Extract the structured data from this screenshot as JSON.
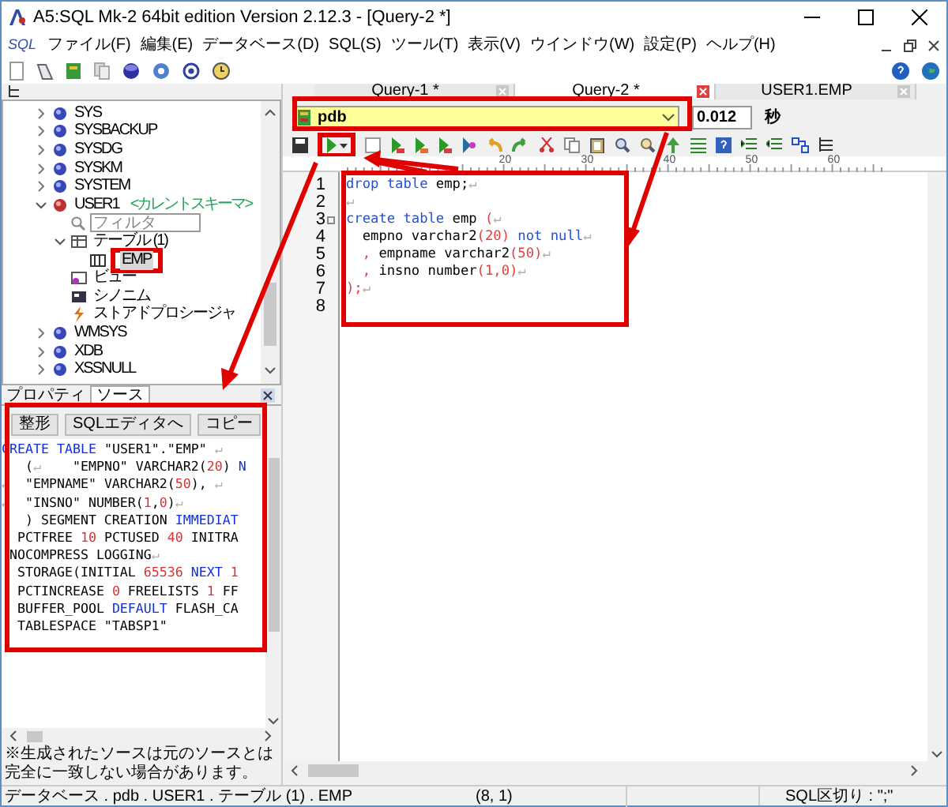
{
  "window": {
    "title": "A5:SQL Mk-2 64bit edition Version 2.12.3 - [Query-2 *]"
  },
  "menu": {
    "logo": "SQL",
    "items": [
      "ファイル(F)",
      "編集(E)",
      "データベース(D)",
      "SQL(S)",
      "ツール(T)",
      "表示(V)",
      "ウインドウ(W)",
      "設定(P)",
      "ヘルプ(H)"
    ]
  },
  "tree": [
    {
      "kind": "schema",
      "label": "SYS",
      "expanded": false,
      "selected": false
    },
    {
      "kind": "schema",
      "label": "SYSBACKUP",
      "expanded": false,
      "selected": false
    },
    {
      "kind": "schema",
      "label": "SYSDG",
      "expanded": false,
      "selected": false
    },
    {
      "kind": "schema",
      "label": "SYSKM",
      "expanded": false,
      "selected": false
    },
    {
      "kind": "schema",
      "label": "SYSTEM",
      "expanded": false,
      "selected": false
    },
    {
      "kind": "current_schema",
      "label": "USER1",
      "note": "<カレントスキーマ>",
      "expanded": true,
      "selected": false,
      "children": [
        {
          "kind": "filter",
          "placeholder": "フィルタ"
        },
        {
          "kind": "tables",
          "label": "テーブル (1)",
          "expanded": true,
          "selected": false,
          "children": [
            {
              "kind": "table",
              "label": "EMP",
              "selected": true,
              "annotated": true
            }
          ]
        },
        {
          "kind": "view",
          "label": "ビュー",
          "selected": false
        },
        {
          "kind": "synonym",
          "label": "シノニム",
          "selected": false
        },
        {
          "kind": "procedure",
          "label": "ストアドプロシージャ",
          "selected": false
        }
      ]
    },
    {
      "kind": "schema",
      "label": "WMSYS",
      "expanded": false,
      "selected": false
    },
    {
      "kind": "schema",
      "label": "XDB",
      "expanded": false,
      "selected": false
    },
    {
      "kind": "schema",
      "label": "XSSNULL",
      "expanded": false,
      "selected": false
    }
  ],
  "left_tabs": [
    {
      "label": "プロパティ",
      "selected": false
    },
    {
      "label": "ソース",
      "selected": true
    }
  ],
  "source_buttons": [
    "整形",
    "SQLエディタへ",
    "コピー"
  ],
  "source_lines": [
    [
      {
        "kind": "keyword",
        "text": "CREATE TABLE"
      },
      {
        "kind": "plain",
        "text": " \"USER1\".\"EMP\" "
      },
      {
        "kind": "eol",
        "text": "↵"
      }
    ],
    [
      {
        "kind": "plain",
        "text": "   ("
      },
      {
        "kind": "eol",
        "text": "↵"
      },
      {
        "kind": "plain",
        "text": "    \"EMPNO\" VARCHAR2("
      },
      {
        "kind": "number",
        "text": "20"
      },
      {
        "kind": "plain",
        "text": ") "
      },
      {
        "kind": "keyword",
        "text": "N"
      }
    ],
    [
      {
        "kind": "eol",
        "text": "↵"
      },
      {
        "kind": "plain",
        "text": "  \"EMPNAME\" VARCHAR2("
      },
      {
        "kind": "number",
        "text": "50"
      },
      {
        "kind": "plain",
        "text": "), "
      },
      {
        "kind": "eol",
        "text": "↵"
      }
    ],
    [
      {
        "kind": "eol",
        "text": "↵"
      },
      {
        "kind": "plain",
        "text": "  \"INSNO\" NUMBER("
      },
      {
        "kind": "number",
        "text": "1"
      },
      {
        "kind": "plain",
        "text": ","
      },
      {
        "kind": "number",
        "text": "0"
      },
      {
        "kind": "plain",
        "text": ")"
      },
      {
        "kind": "eol",
        "text": "↵"
      }
    ],
    [
      {
        "kind": "plain",
        "text": "   ) SEGMENT CREATION "
      },
      {
        "kind": "keyword",
        "text": "IMMEDIAT"
      }
    ],
    [
      {
        "kind": "plain",
        "text": "  PCTFREE "
      },
      {
        "kind": "number",
        "text": "10"
      },
      {
        "kind": "plain",
        "text": " PCTUSED "
      },
      {
        "kind": "number",
        "text": "40"
      },
      {
        "kind": "plain",
        "text": " INITRA"
      }
    ],
    [
      {
        "kind": "plain",
        "text": " NOCOMPRESS LOGGING"
      },
      {
        "kind": "eol",
        "text": "↵"
      }
    ],
    [
      {
        "kind": "plain",
        "text": "  STORAGE(INITIAL "
      },
      {
        "kind": "number",
        "text": "65536"
      },
      {
        "kind": "keyword",
        "text": " NEXT "
      },
      {
        "kind": "number",
        "text": "1"
      }
    ],
    [
      {
        "kind": "plain",
        "text": "  PCTINCREASE "
      },
      {
        "kind": "number",
        "text": "0"
      },
      {
        "kind": "plain",
        "text": " FREELISTS "
      },
      {
        "kind": "number",
        "text": "1"
      },
      {
        "kind": "plain",
        "text": " FF"
      }
    ],
    [
      {
        "kind": "plain",
        "text": "  BUFFER_POOL "
      },
      {
        "kind": "keyword",
        "text": "DEFAULT"
      },
      {
        "kind": "plain",
        "text": " FLASH_CA"
      }
    ],
    [
      {
        "kind": "plain",
        "text": "  TABLESPACE \"TABSP1\""
      }
    ]
  ],
  "source_note": "※生成されたソースは元のソースとは完全に一致しない場合があります。",
  "editor_tabs": [
    {
      "label": "Query-1 *",
      "selected": false
    },
    {
      "label": "Query-2 *",
      "selected": true
    },
    {
      "label": "USER1.EMP",
      "selected": false
    }
  ],
  "connection": {
    "value": "pdb",
    "elapsed": "0.012",
    "unit": "秒"
  },
  "ruler": [
    "20",
    "30",
    "40",
    "50",
    "60"
  ],
  "editor_lines": [
    {
      "number": "1",
      "fold": false,
      "parts": [
        {
          "kind": "keyword",
          "text": "drop table"
        },
        {
          "kind": "plain",
          "text": " emp;"
        },
        {
          "kind": "eol",
          "text": "↵"
        }
      ]
    },
    {
      "number": "2",
      "fold": false,
      "parts": [
        {
          "kind": "eol",
          "text": "↵"
        }
      ]
    },
    {
      "number": "3",
      "fold": true,
      "parts": [
        {
          "kind": "keyword",
          "text": "create table"
        },
        {
          "kind": "plain",
          "text": " emp "
        },
        {
          "kind": "number",
          "text": "("
        },
        {
          "kind": "eol",
          "text": "↵"
        }
      ]
    },
    {
      "number": "4",
      "fold": false,
      "parts": [
        {
          "kind": "plain",
          "text": "  empno varchar2"
        },
        {
          "kind": "number",
          "text": "(20)"
        },
        {
          "kind": "keyword",
          "text": " not null"
        },
        {
          "kind": "eol",
          "text": "↵"
        }
      ]
    },
    {
      "number": "5",
      "fold": false,
      "parts": [
        {
          "kind": "number",
          "text": "  ,"
        },
        {
          "kind": "plain",
          "text": " empname varchar2"
        },
        {
          "kind": "number",
          "text": "(50)"
        },
        {
          "kind": "eol",
          "text": "↵"
        }
      ]
    },
    {
      "number": "6",
      "fold": false,
      "parts": [
        {
          "kind": "number",
          "text": "  ,"
        },
        {
          "kind": "plain",
          "text": " insno number"
        },
        {
          "kind": "number",
          "text": "(1,0)"
        },
        {
          "kind": "eol",
          "text": "↵"
        }
      ]
    },
    {
      "number": "7",
      "fold": false,
      "parts": [
        {
          "kind": "number",
          "text": ");"
        },
        {
          "kind": "eol",
          "text": "↵"
        }
      ]
    },
    {
      "number": "8",
      "fold": false
    }
  ],
  "status_bar": {
    "path": "データベース . pdb . USER1 . テーブル (1) . EMP",
    "position": "(8, 1)",
    "delimiter": "SQL区切り : \";\""
  }
}
